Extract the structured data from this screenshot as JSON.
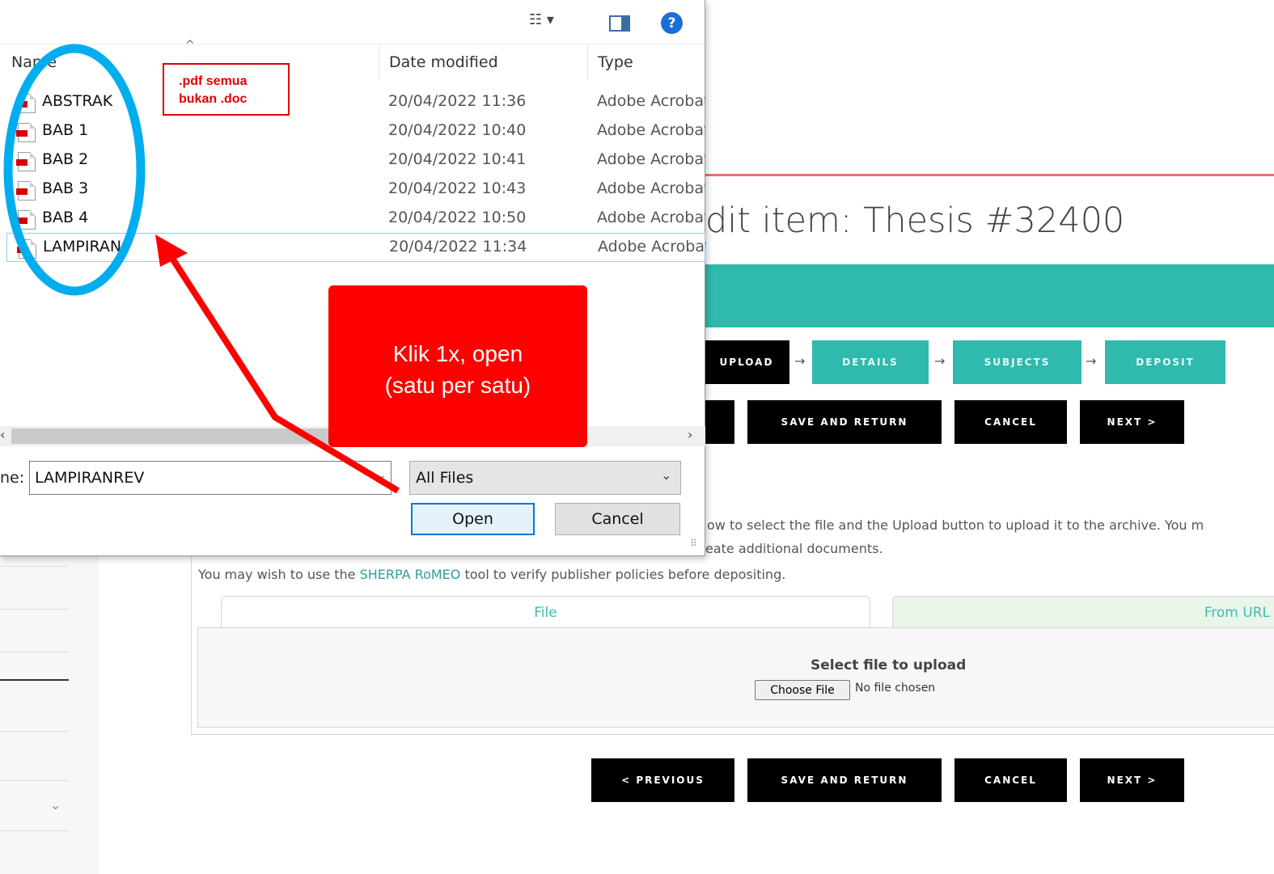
{
  "page": {
    "title": "dit item: Thesis #32400",
    "stages": [
      {
        "label": "UPLOAD",
        "state": "active"
      },
      {
        "label": "DETAILS",
        "state": "idle"
      },
      {
        "label": "SUBJECTS",
        "state": "idle"
      },
      {
        "label": "DEPOSIT",
        "state": "idle"
      }
    ],
    "arrow_glyph": "→",
    "top_buttons": {
      "save_return": "SAVE AND RETURN",
      "cancel": "CANCEL",
      "next": "NEXT >"
    },
    "bottom_buttons": {
      "previous": "< PREVIOUS",
      "save_return": "SAVE AND RETURN",
      "cancel": "CANCEL",
      "next": "NEXT >"
    },
    "help_line1": "ow to select the file and the Upload button to upload it to the archive. You m",
    "help_line2": "eate additional documents.",
    "help_line3_pre": "You may wish to use the ",
    "help_line3_link": "SHERPA RoMEO",
    "help_line3_post": " tool to verify publisher policies before depositing.",
    "tabs": {
      "file": "File",
      "url": "From URL"
    },
    "upload": {
      "title": "Select file to upload",
      "choose_label": "Choose File",
      "status": "No file chosen"
    },
    "left_chevron": "⌄"
  },
  "dialog": {
    "columns": {
      "name": "Name",
      "date": "Date modified",
      "type": "Type"
    },
    "sort_caret": "^",
    "files": [
      {
        "name": "ABSTRAK",
        "date": "20/04/2022 11:36",
        "type": "Adobe Acrobat"
      },
      {
        "name": "BAB 1",
        "date": "20/04/2022 10:40",
        "type": "Adobe Acrobat"
      },
      {
        "name": "BAB 2",
        "date": "20/04/2022 10:41",
        "type": "Adobe Acrobat"
      },
      {
        "name": "BAB 3",
        "date": "20/04/2022 10:43",
        "type": "Adobe Acrobat"
      },
      {
        "name": "BAB 4",
        "date": "20/04/2022 10:50",
        "type": "Adobe Acrobat"
      },
      {
        "name": "LAMPIRAN",
        "date": "20/04/2022 11:34",
        "type": "Adobe Acrobat"
      }
    ],
    "filename_label": "ne:",
    "filename_value": "LAMPIRANREV",
    "filter_value": "All Files",
    "open_label": "Open",
    "cancel_label": "Cancel",
    "toolbar": {
      "view_icon": "view-menu-icon",
      "preview_icon": "preview-pane-icon",
      "help_icon": "help-icon",
      "help_glyph": "?",
      "view_glyph": "☷ ▾"
    },
    "scroll_left": "‹",
    "scroll_right": "›",
    "chevron": "⌄"
  },
  "annotations": {
    "note": ".pdf semua bukan .doc",
    "note_line1": ".pdf semua",
    "note_line2": "bukan .doc",
    "callout_line1": "Klik 1x, open",
    "callout_line2": "(satu per satu)",
    "colors": {
      "red": "#ff0000",
      "circle": "#00aeef"
    }
  },
  "colors": {
    "teal": "#30b9ad",
    "black_button": "#000000",
    "red_rule": "#e57373"
  }
}
